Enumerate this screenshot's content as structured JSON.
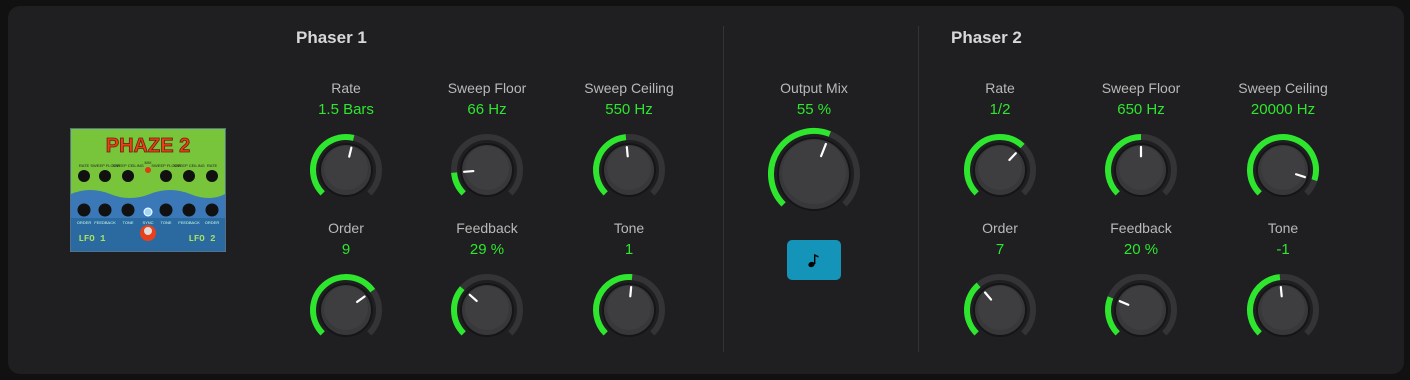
{
  "phaser1": {
    "title": "Phaser 1",
    "knobs": [
      {
        "id": "rate",
        "label": "Rate",
        "value": "1.5 Bars",
        "level": 0.55
      },
      {
        "id": "sweep-floor",
        "label": "Sweep Floor",
        "value": "66 Hz",
        "level": 0.15
      },
      {
        "id": "sweep-ceiling",
        "label": "Sweep Ceiling",
        "value": "550 Hz",
        "level": 0.48
      },
      {
        "id": "order",
        "label": "Order",
        "value": "9",
        "level": 0.7
      },
      {
        "id": "feedback",
        "label": "Feedback",
        "value": "29 %",
        "level": 0.32
      },
      {
        "id": "tone",
        "label": "Tone",
        "value": "1",
        "level": 0.52
      }
    ]
  },
  "output": {
    "label": "Output Mix",
    "value": "55 %",
    "level": 0.58,
    "sync_icon": "music-note-icon"
  },
  "phaser2": {
    "title": "Phaser 2",
    "knobs": [
      {
        "id": "rate",
        "label": "Rate",
        "value": "1/2",
        "level": 0.66
      },
      {
        "id": "sweep-floor",
        "label": "Sweep Floor",
        "value": "650 Hz",
        "level": 0.5
      },
      {
        "id": "sweep-ceiling",
        "label": "Sweep Ceiling",
        "value": "20000 Hz",
        "level": 0.9
      },
      {
        "id": "order",
        "label": "Order",
        "value": "7",
        "level": 0.35
      },
      {
        "id": "feedback",
        "label": "Feedback",
        "value": "20 %",
        "level": 0.25
      },
      {
        "id": "tone",
        "label": "Tone",
        "value": "-1",
        "level": 0.48
      }
    ]
  },
  "pedal": {
    "name": "PHAZE 2",
    "lfo1": "LFO 1",
    "lfo2": "LFO 2",
    "top_labels": [
      "RATE",
      "SWEEP FLOOR",
      "SWEEP CEILING",
      "MIX",
      "SWEEP FLOOR",
      "SWEEP CEILING",
      "RATE"
    ],
    "bottom_labels": [
      "ORDER",
      "FEEDBACK",
      "TONE",
      "SYNC",
      "TONE",
      "FEEDBACK",
      "ORDER"
    ]
  },
  "colors": {
    "accent": "#2ee62e",
    "track": "#343437",
    "knob": "#3a3a3d",
    "sync": "#1494b8"
  }
}
